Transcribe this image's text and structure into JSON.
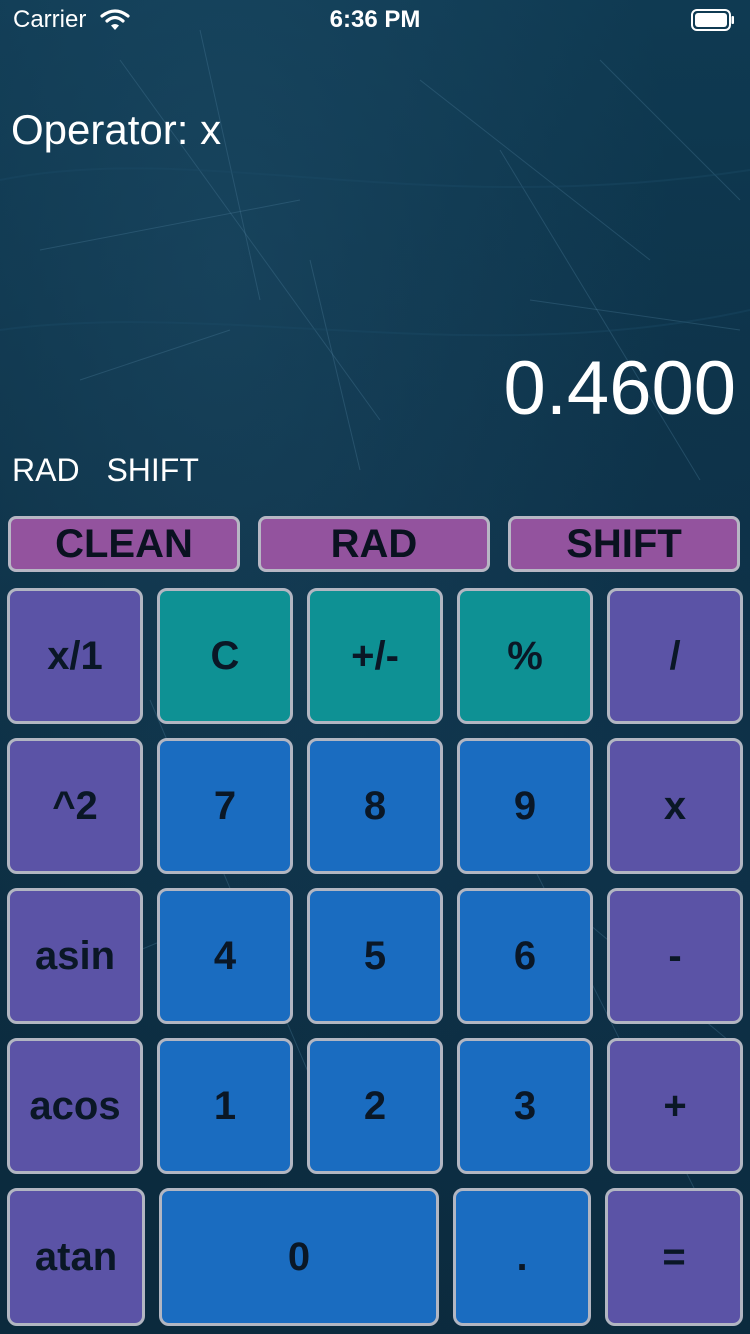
{
  "status_bar": {
    "carrier": "Carrier",
    "time": "6:36 PM",
    "icons": [
      "wifi-icon",
      "battery-icon"
    ]
  },
  "display": {
    "operator": "Operator: x",
    "value": "0.4600",
    "modes": [
      "RAD",
      "SHIFT"
    ]
  },
  "top_buttons": {
    "clean": "CLEAN",
    "rad": "RAD",
    "shift": "SHIFT"
  },
  "keys": {
    "row1": [
      "x/1",
      "C",
      "+/-",
      "%",
      "/"
    ],
    "row2": [
      "^2",
      "7",
      "8",
      "9",
      "x"
    ],
    "row3": [
      "asin",
      "4",
      "5",
      "6",
      "-"
    ],
    "row4": [
      "acos",
      "1",
      "2",
      "3",
      "+"
    ],
    "row5": [
      "atan",
      "0",
      ".",
      "="
    ]
  },
  "colors": {
    "background": "#0d3147",
    "purple_key": "#5b53a6",
    "teal_key": "#0e9194",
    "blue_key": "#1a6cc0",
    "pill": "#93539e",
    "border": "#b2b6c2"
  }
}
